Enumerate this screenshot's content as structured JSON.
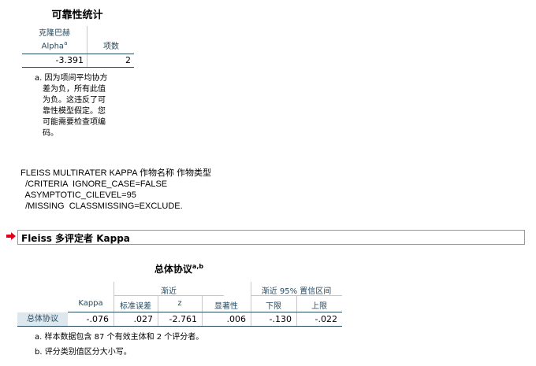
{
  "reliability": {
    "title": "可靠性统计",
    "col1_header": "克隆巴赫",
    "col1_header_line2": "Alpha",
    "col1_header_sup": "a",
    "col2_header": "项数",
    "alpha_value": "-3.391",
    "items_value": "2",
    "footnote_lines": [
      "a. 因为项间平均协方",
      "差为负，所有此值",
      "为负。这违反了可",
      "靠性模型假定。您",
      "可能需要检查项编",
      "码。"
    ]
  },
  "syntax": {
    "lines": [
      "FLEISS MULTIRATER KAPPA 作物名称 作物类型",
      "  /CRITERIA  IGNORE_CASE=FALSE",
      "  ASYMPTOTIC_CILEVEL=95",
      "  /MISSING  CLASSMISSING=EXCLUDE."
    ]
  },
  "section_header": {
    "title": "Fleiss 多评定者 Kappa",
    "arrow_color": "#e0001b"
  },
  "overall": {
    "title": "总体协议",
    "title_sup": "a,b",
    "headers": {
      "kappa": "Kappa",
      "asymptotic": "渐近",
      "se": "标准误差",
      "z": "z",
      "sig": "显著性",
      "ci": "渐近 95% 置信区间",
      "lower": "下限",
      "upper": "上限"
    },
    "row_label": "总体协议",
    "values": {
      "kappa": "-.076",
      "se": ".027",
      "z": "-2.761",
      "sig": ".006",
      "lower": "-.130",
      "upper": "-.022"
    },
    "footnotes": [
      "a. 样本数据包含 87 个有效主体和 2 个评分者。",
      "b. 评分类别值区分大小写。"
    ]
  },
  "colors": {
    "header_text": "#264a60",
    "row_label_bg": "#dde7ee",
    "grid": "#c8c8c8"
  }
}
